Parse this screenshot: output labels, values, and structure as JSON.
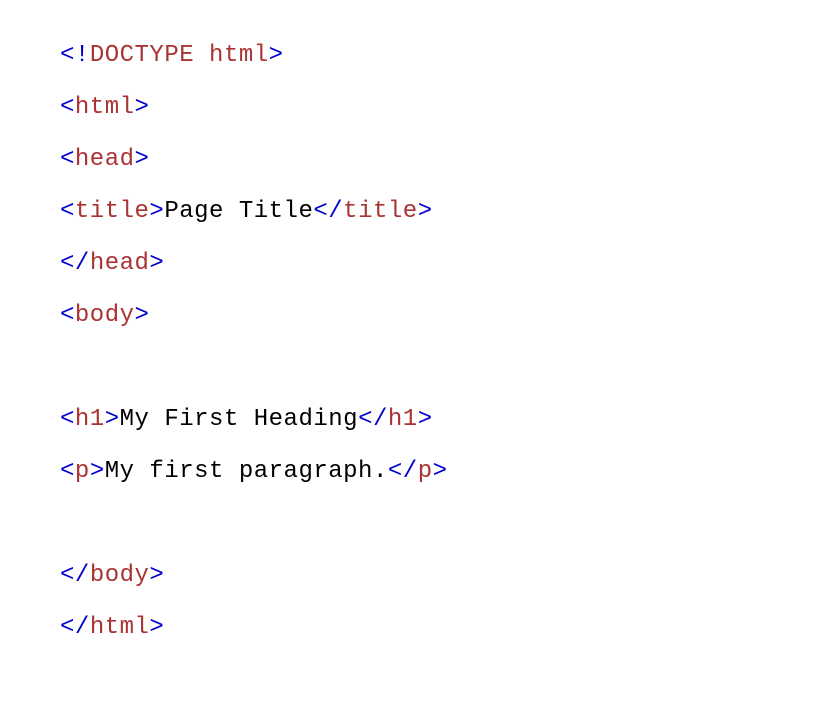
{
  "code": {
    "line1": {
      "open": "<!",
      "doctype": "DOCTYPE",
      "space": " ",
      "html": "html",
      "close": ">"
    },
    "line2": {
      "open": "<",
      "tag": "html",
      "close": ">"
    },
    "line3": {
      "open": "<",
      "tag": "head",
      "close": ">"
    },
    "line4": {
      "open1": "<",
      "tag1": "title",
      "close1": ">",
      "text": "Page Title",
      "open2": "</",
      "tag2": "title",
      "close2": ">"
    },
    "line5": {
      "open": "</",
      "tag": "head",
      "close": ">"
    },
    "line6": {
      "open": "<",
      "tag": "body",
      "close": ">"
    },
    "line7": {
      "open1": "<",
      "tag1": "h1",
      "close1": ">",
      "text": "My First Heading",
      "open2": "</",
      "tag2": "h1",
      "close2": ">"
    },
    "line8": {
      "open1": "<",
      "tag1": "p",
      "close1": ">",
      "text": "My first paragraph.",
      "open2": "</",
      "tag2": "p",
      "close2": ">"
    },
    "line9": {
      "open": "</",
      "tag": "body",
      "close": ">"
    },
    "line10": {
      "open": "</",
      "tag": "html",
      "close": ">"
    }
  }
}
